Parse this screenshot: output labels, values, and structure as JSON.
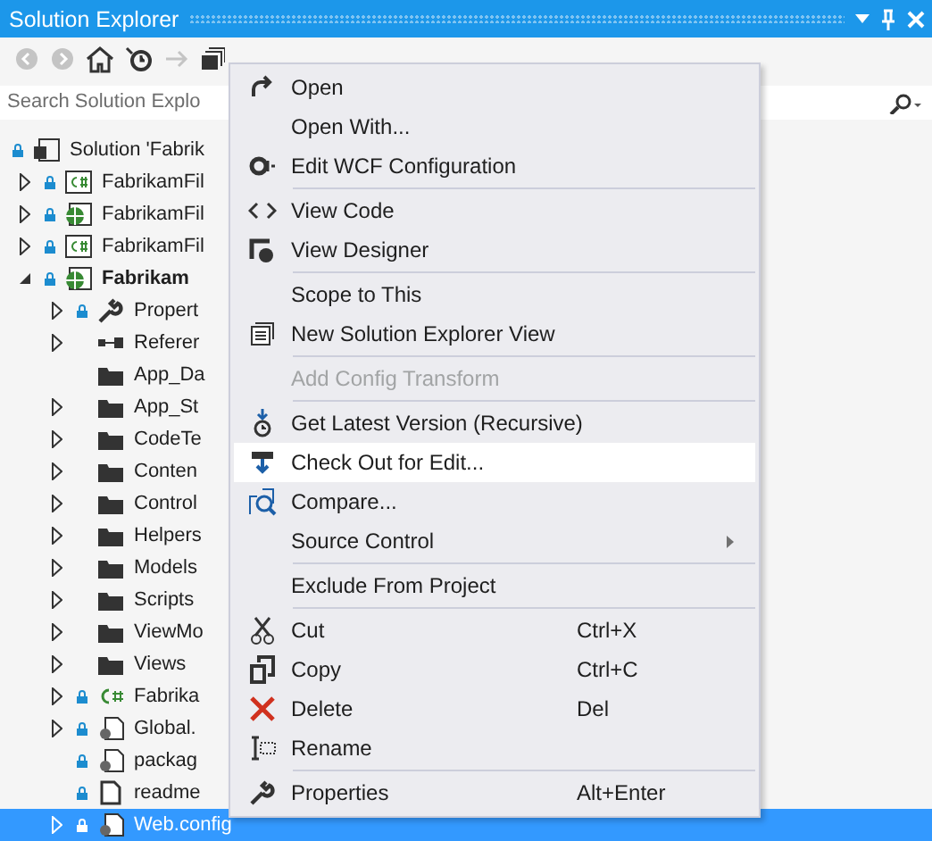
{
  "window": {
    "title": "Solution Explorer"
  },
  "search": {
    "placeholder": "Search Solution Explo"
  },
  "tree": [
    {
      "label": "Solution 'Fabrik",
      "kind": "solution",
      "locked": true,
      "selected": false,
      "children": [
        {
          "label": "FabrikamFil",
          "kind": "csharp",
          "locked": true,
          "expanded": false,
          "selected": false
        },
        {
          "label": "FabrikamFil",
          "kind": "web",
          "locked": true,
          "expanded": false,
          "selected": false
        },
        {
          "label": "FabrikamFil",
          "kind": "csharp",
          "locked": true,
          "expanded": false,
          "selected": false
        },
        {
          "label": "Fabrikam",
          "kind": "web",
          "locked": true,
          "expanded": true,
          "selected": false,
          "children": [
            {
              "label": "Propert",
              "kind": "properties",
              "locked": true,
              "expanded": false,
              "selected": false
            },
            {
              "label": "Referer",
              "kind": "references",
              "locked": false,
              "expanded": false,
              "selected": false
            },
            {
              "label": "App_Da",
              "kind": "folder",
              "locked": false,
              "selected": false
            },
            {
              "label": "App_St",
              "kind": "folder",
              "locked": false,
              "expanded": false,
              "selected": false
            },
            {
              "label": "CodeTe",
              "kind": "folder",
              "locked": false,
              "expanded": false,
              "selected": false
            },
            {
              "label": "Conten",
              "kind": "folder",
              "locked": false,
              "expanded": false,
              "selected": false
            },
            {
              "label": "Control",
              "kind": "folder",
              "locked": false,
              "expanded": false,
              "selected": false
            },
            {
              "label": "Helpers",
              "kind": "folder",
              "locked": false,
              "expanded": false,
              "selected": false
            },
            {
              "label": "Models",
              "kind": "folder",
              "locked": false,
              "expanded": false,
              "selected": false
            },
            {
              "label": "Scripts",
              "kind": "folder",
              "locked": false,
              "expanded": false,
              "selected": false
            },
            {
              "label": "ViewMo",
              "kind": "folder",
              "locked": false,
              "expanded": false,
              "selected": false
            },
            {
              "label": "Views",
              "kind": "folder",
              "locked": false,
              "expanded": false,
              "selected": false
            },
            {
              "label": "Fabrika",
              "kind": "cs-file",
              "locked": true,
              "expanded": false,
              "selected": false
            },
            {
              "label": "Global.",
              "kind": "config",
              "locked": true,
              "expanded": false,
              "selected": false
            },
            {
              "label": "packag",
              "kind": "config",
              "locked": true,
              "selected": false
            },
            {
              "label": "readme",
              "kind": "file",
              "locked": true,
              "selected": false
            },
            {
              "label": "Web.config",
              "kind": "config",
              "locked": true,
              "expanded": false,
              "selected": true
            }
          ]
        }
      ]
    }
  ],
  "context_menu": [
    {
      "kind": "item",
      "label": "Open",
      "selected": false,
      "disabled": false
    },
    {
      "kind": "item",
      "label": "Open With...",
      "selected": false,
      "disabled": false
    },
    {
      "kind": "item",
      "label": "Edit WCF Configuration",
      "selected": false,
      "disabled": false
    },
    {
      "kind": "separator"
    },
    {
      "kind": "item",
      "label": "View Code",
      "selected": false,
      "disabled": false
    },
    {
      "kind": "item",
      "label": "View Designer",
      "selected": false,
      "disabled": false
    },
    {
      "kind": "separator"
    },
    {
      "kind": "item",
      "label": "Scope to This",
      "selected": false,
      "disabled": false
    },
    {
      "kind": "item",
      "label": "New Solution Explorer View",
      "selected": false,
      "disabled": false
    },
    {
      "kind": "separator"
    },
    {
      "kind": "item",
      "label": "Add Config Transform",
      "selected": false,
      "disabled": true
    },
    {
      "kind": "separator"
    },
    {
      "kind": "item",
      "label": "Get Latest Version (Recursive)",
      "selected": false,
      "disabled": false
    },
    {
      "kind": "item",
      "label": "Check Out for Edit...",
      "selected": true,
      "disabled": false
    },
    {
      "kind": "item",
      "label": "Compare...",
      "selected": false,
      "disabled": false
    },
    {
      "kind": "item",
      "label": "Source Control",
      "selected": false,
      "disabled": false,
      "submenu": true
    },
    {
      "kind": "separator"
    },
    {
      "kind": "item",
      "label": "Exclude From Project",
      "selected": false,
      "disabled": false
    },
    {
      "kind": "separator"
    },
    {
      "kind": "item",
      "label": "Cut",
      "shortcut": "Ctrl+X",
      "selected": false,
      "disabled": false
    },
    {
      "kind": "item",
      "label": "Copy",
      "shortcut": "Ctrl+C",
      "selected": false,
      "disabled": false
    },
    {
      "kind": "item",
      "label": "Delete",
      "shortcut": "Del",
      "selected": false,
      "disabled": false
    },
    {
      "kind": "item",
      "label": "Rename",
      "selected": false,
      "disabled": false
    },
    {
      "kind": "separator"
    },
    {
      "kind": "item",
      "label": "Properties",
      "shortcut": "Alt+Enter",
      "selected": false,
      "disabled": false
    }
  ]
}
